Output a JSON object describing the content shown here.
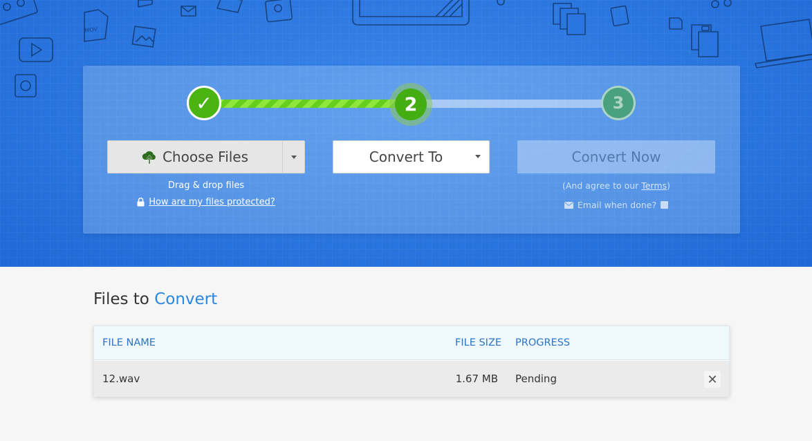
{
  "colors": {
    "hero_bg": "#2a75df",
    "accent": "#2a87e0",
    "step_done": "#4cb412",
    "progress_stripe": "#66cf1e"
  },
  "stepper": {
    "step1": {
      "label": "✓",
      "state": "done"
    },
    "step2": {
      "label": "2",
      "state": "active"
    },
    "step3": {
      "label": "3",
      "state": "pending"
    }
  },
  "upload": {
    "choose_label": "Choose Files",
    "choose_icon": "cloud-upload-icon",
    "drag_text": "Drag & drop files",
    "protected_link": "How are my files protected?",
    "protected_icon": "lock-icon"
  },
  "convert_to": {
    "label": "Convert To"
  },
  "convert_now": {
    "label": "Convert Now",
    "agree_prefix": "(And agree to our ",
    "terms_link": "Terms",
    "agree_suffix": ")",
    "email_label": "Email when done?",
    "email_icon": "envelope-icon"
  },
  "files_section": {
    "title_prefix": "Files to",
    "title_accent": "Convert",
    "columns": {
      "name": "FILE NAME",
      "size": "FILE SIZE",
      "progress": "PROGRESS"
    },
    "rows": [
      {
        "name": "12.wav",
        "size": "1.67 MB",
        "progress": "Pending"
      }
    ],
    "remove_icon": "close-icon"
  }
}
